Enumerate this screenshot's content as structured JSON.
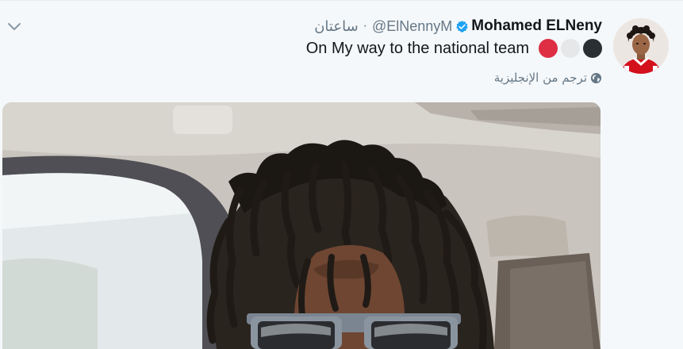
{
  "tweet": {
    "display_name": "Mohamed ELNeny",
    "handle": "@ElNennyM",
    "separator": "·",
    "timestamp": "ساعتان",
    "text": "On My way to the national team",
    "emojis": [
      {
        "name": "red-circle-emoji",
        "color": "#dd2e44"
      },
      {
        "name": "white-circle-emoji",
        "color": "#e6e7e8"
      },
      {
        "name": "black-circle-emoji",
        "color": "#292f33"
      }
    ],
    "translate_label": "ترجم من الإنجليزية",
    "verified": true
  },
  "colors": {
    "background": "#f5f8fa",
    "text_primary": "#14171a",
    "text_secondary": "#657786",
    "verified_blue": "#1da1f2"
  },
  "icons": {
    "caret": "chevron-down-icon",
    "verified": "verified-badge-icon",
    "globe": "globe-icon"
  }
}
